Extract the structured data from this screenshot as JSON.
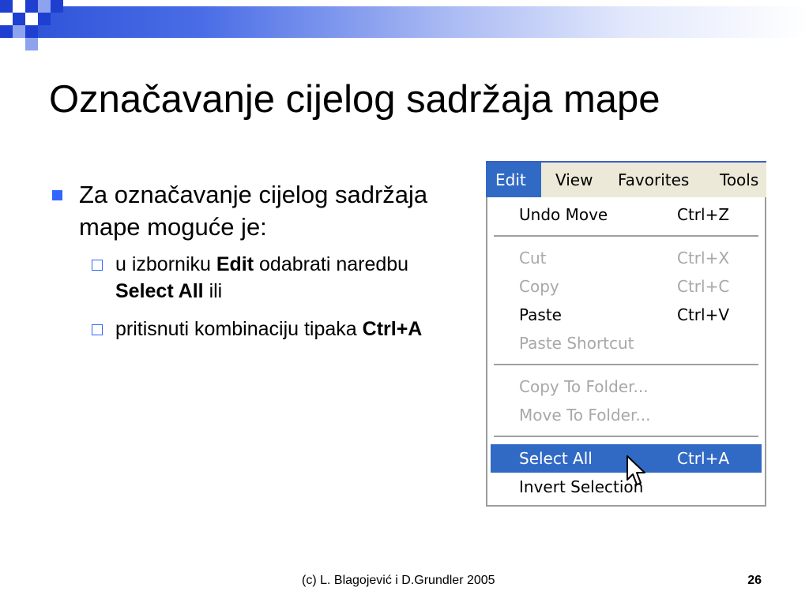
{
  "slide": {
    "title": "Označavanje cijelog sadržaja mape",
    "bullet": "Za označavanje cijelog sadržaja mape moguće je:",
    "sub1": {
      "pre": "u izborniku ",
      "b1": "Edit",
      "mid": " odabrati naredbu ",
      "b2": "Select All",
      "post": " ili"
    },
    "sub2": {
      "pre": "pritisnuti kombinaciju tipaka ",
      "b1": "Ctrl+A"
    },
    "footer": "(c) L. Blagojević i D.Grundler 2005",
    "page_number": "26"
  },
  "menubar": {
    "items": [
      {
        "label": "Edit",
        "active": true
      },
      {
        "label": "View"
      },
      {
        "label": "Favorites"
      },
      {
        "label": "Tools"
      }
    ]
  },
  "edit_menu": {
    "items": [
      {
        "label": "Undo Move",
        "shortcut": "Ctrl+Z",
        "enabled": true
      },
      {
        "label": "Cut",
        "shortcut": "Ctrl+X",
        "enabled": false
      },
      {
        "label": "Copy",
        "shortcut": "Ctrl+C",
        "enabled": false
      },
      {
        "label": "Paste",
        "shortcut": "Ctrl+V",
        "enabled": true
      },
      {
        "label": "Paste Shortcut",
        "shortcut": "",
        "enabled": false
      },
      {
        "label": "Copy To Folder...",
        "shortcut": "",
        "enabled": false
      },
      {
        "label": "Move To Folder...",
        "shortcut": "",
        "enabled": false
      },
      {
        "label": "Select All",
        "shortcut": "Ctrl+A",
        "enabled": true,
        "highlighted": true
      },
      {
        "label": "Invert Selection",
        "shortcut": "",
        "enabled": true
      }
    ]
  },
  "colors": {
    "highlight": "#316ac5",
    "bullet": "#3366ff",
    "menubar_bg": "#ece9d8",
    "disabled_text": "#a8a8a8"
  }
}
